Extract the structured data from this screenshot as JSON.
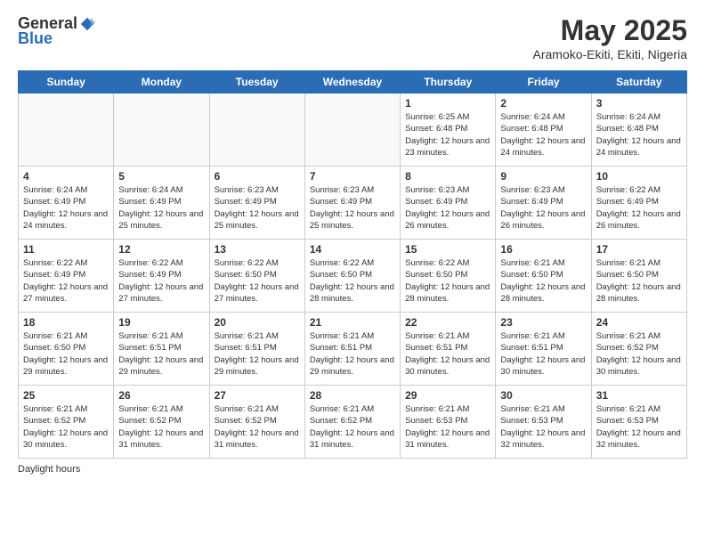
{
  "header": {
    "logo_general": "General",
    "logo_blue": "Blue",
    "month_title": "May 2025",
    "location": "Aramoko-Ekiti, Ekiti, Nigeria"
  },
  "days_of_week": [
    "Sunday",
    "Monday",
    "Tuesday",
    "Wednesday",
    "Thursday",
    "Friday",
    "Saturday"
  ],
  "weeks": [
    [
      {
        "day": "",
        "info": ""
      },
      {
        "day": "",
        "info": ""
      },
      {
        "day": "",
        "info": ""
      },
      {
        "day": "",
        "info": ""
      },
      {
        "day": "1",
        "info": "Sunrise: 6:25 AM\nSunset: 6:48 PM\nDaylight: 12 hours\nand 23 minutes."
      },
      {
        "day": "2",
        "info": "Sunrise: 6:24 AM\nSunset: 6:48 PM\nDaylight: 12 hours\nand 24 minutes."
      },
      {
        "day": "3",
        "info": "Sunrise: 6:24 AM\nSunset: 6:48 PM\nDaylight: 12 hours\nand 24 minutes."
      }
    ],
    [
      {
        "day": "4",
        "info": "Sunrise: 6:24 AM\nSunset: 6:49 PM\nDaylight: 12 hours\nand 24 minutes."
      },
      {
        "day": "5",
        "info": "Sunrise: 6:24 AM\nSunset: 6:49 PM\nDaylight: 12 hours\nand 25 minutes."
      },
      {
        "day": "6",
        "info": "Sunrise: 6:23 AM\nSunset: 6:49 PM\nDaylight: 12 hours\nand 25 minutes."
      },
      {
        "day": "7",
        "info": "Sunrise: 6:23 AM\nSunset: 6:49 PM\nDaylight: 12 hours\nand 25 minutes."
      },
      {
        "day": "8",
        "info": "Sunrise: 6:23 AM\nSunset: 6:49 PM\nDaylight: 12 hours\nand 26 minutes."
      },
      {
        "day": "9",
        "info": "Sunrise: 6:23 AM\nSunset: 6:49 PM\nDaylight: 12 hours\nand 26 minutes."
      },
      {
        "day": "10",
        "info": "Sunrise: 6:22 AM\nSunset: 6:49 PM\nDaylight: 12 hours\nand 26 minutes."
      }
    ],
    [
      {
        "day": "11",
        "info": "Sunrise: 6:22 AM\nSunset: 6:49 PM\nDaylight: 12 hours\nand 27 minutes."
      },
      {
        "day": "12",
        "info": "Sunrise: 6:22 AM\nSunset: 6:49 PM\nDaylight: 12 hours\nand 27 minutes."
      },
      {
        "day": "13",
        "info": "Sunrise: 6:22 AM\nSunset: 6:50 PM\nDaylight: 12 hours\nand 27 minutes."
      },
      {
        "day": "14",
        "info": "Sunrise: 6:22 AM\nSunset: 6:50 PM\nDaylight: 12 hours\nand 28 minutes."
      },
      {
        "day": "15",
        "info": "Sunrise: 6:22 AM\nSunset: 6:50 PM\nDaylight: 12 hours\nand 28 minutes."
      },
      {
        "day": "16",
        "info": "Sunrise: 6:21 AM\nSunset: 6:50 PM\nDaylight: 12 hours\nand 28 minutes."
      },
      {
        "day": "17",
        "info": "Sunrise: 6:21 AM\nSunset: 6:50 PM\nDaylight: 12 hours\nand 28 minutes."
      }
    ],
    [
      {
        "day": "18",
        "info": "Sunrise: 6:21 AM\nSunset: 6:50 PM\nDaylight: 12 hours\nand 29 minutes."
      },
      {
        "day": "19",
        "info": "Sunrise: 6:21 AM\nSunset: 6:51 PM\nDaylight: 12 hours\nand 29 minutes."
      },
      {
        "day": "20",
        "info": "Sunrise: 6:21 AM\nSunset: 6:51 PM\nDaylight: 12 hours\nand 29 minutes."
      },
      {
        "day": "21",
        "info": "Sunrise: 6:21 AM\nSunset: 6:51 PM\nDaylight: 12 hours\nand 29 minutes."
      },
      {
        "day": "22",
        "info": "Sunrise: 6:21 AM\nSunset: 6:51 PM\nDaylight: 12 hours\nand 30 minutes."
      },
      {
        "day": "23",
        "info": "Sunrise: 6:21 AM\nSunset: 6:51 PM\nDaylight: 12 hours\nand 30 minutes."
      },
      {
        "day": "24",
        "info": "Sunrise: 6:21 AM\nSunset: 6:52 PM\nDaylight: 12 hours\nand 30 minutes."
      }
    ],
    [
      {
        "day": "25",
        "info": "Sunrise: 6:21 AM\nSunset: 6:52 PM\nDaylight: 12 hours\nand 30 minutes."
      },
      {
        "day": "26",
        "info": "Sunrise: 6:21 AM\nSunset: 6:52 PM\nDaylight: 12 hours\nand 31 minutes."
      },
      {
        "day": "27",
        "info": "Sunrise: 6:21 AM\nSunset: 6:52 PM\nDaylight: 12 hours\nand 31 minutes."
      },
      {
        "day": "28",
        "info": "Sunrise: 6:21 AM\nSunset: 6:52 PM\nDaylight: 12 hours\nand 31 minutes."
      },
      {
        "day": "29",
        "info": "Sunrise: 6:21 AM\nSunset: 6:53 PM\nDaylight: 12 hours\nand 31 minutes."
      },
      {
        "day": "30",
        "info": "Sunrise: 6:21 AM\nSunset: 6:53 PM\nDaylight: 12 hours\nand 32 minutes."
      },
      {
        "day": "31",
        "info": "Sunrise: 6:21 AM\nSunset: 6:53 PM\nDaylight: 12 hours\nand 32 minutes."
      }
    ]
  ],
  "footer": {
    "text": "Daylight hours"
  }
}
